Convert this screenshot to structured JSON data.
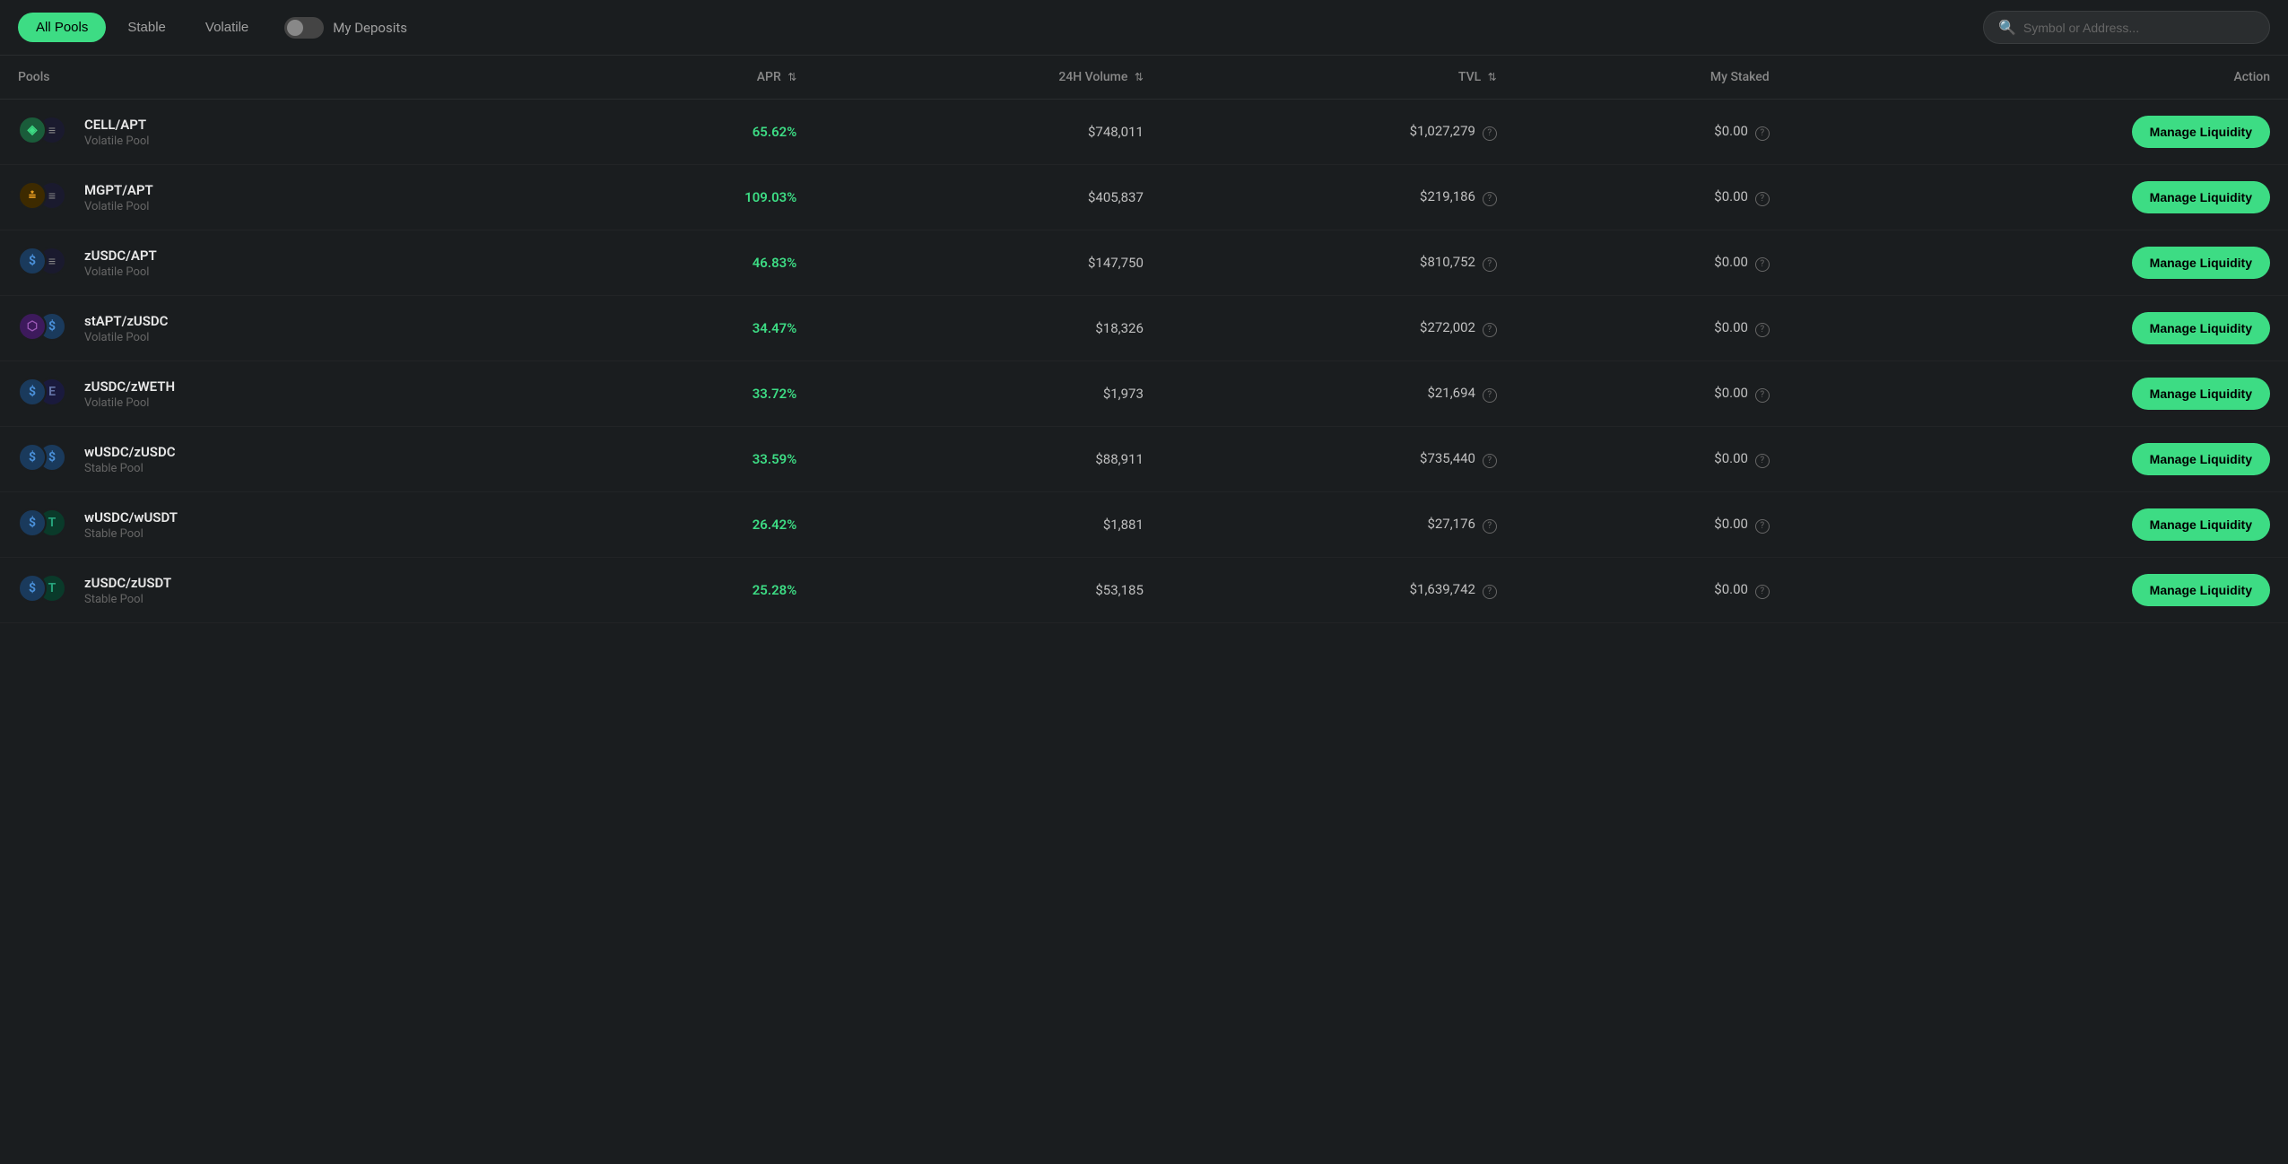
{
  "header": {
    "tabs": [
      {
        "id": "all",
        "label": "All Pools",
        "active": true
      },
      {
        "id": "stable",
        "label": "Stable",
        "active": false
      },
      {
        "id": "volatile",
        "label": "Volatile",
        "active": false
      }
    ],
    "toggle_label": "My Deposits",
    "search_placeholder": "Symbol or Address..."
  },
  "table": {
    "columns": [
      {
        "id": "pools",
        "label": "Pools",
        "sortable": false
      },
      {
        "id": "apr",
        "label": "APR",
        "sortable": true
      },
      {
        "id": "volume",
        "label": "24H Volume",
        "sortable": true
      },
      {
        "id": "tvl",
        "label": "TVL",
        "sortable": true
      },
      {
        "id": "staked",
        "label": "My Staked",
        "sortable": false
      },
      {
        "id": "action",
        "label": "Action",
        "sortable": false
      }
    ],
    "rows": [
      {
        "id": "cell-apt",
        "name": "CELL/APT",
        "type": "Volatile Pool",
        "icon1": "C",
        "icon2": "≡",
        "apr": "65.62%",
        "volume": "$748,011",
        "tvl": "$1,027,279",
        "staked": "$0.00",
        "btn": "Manage Liquidity"
      },
      {
        "id": "mgpt-apt",
        "name": "MGPT/APT",
        "type": "Volatile Pool",
        "icon1": "M",
        "icon2": "≡",
        "apr": "109.03%",
        "volume": "$405,837",
        "tvl": "$219,186",
        "staked": "$0.00",
        "btn": "Manage Liquidity"
      },
      {
        "id": "zusdc-apt",
        "name": "zUSDC/APT",
        "type": "Volatile Pool",
        "icon1": "$",
        "icon2": "≡",
        "apr": "46.83%",
        "volume": "$147,750",
        "tvl": "$810,752",
        "staked": "$0.00",
        "btn": "Manage Liquidity"
      },
      {
        "id": "stapt-zusdc",
        "name": "stAPT/zUSDC",
        "type": "Volatile Pool",
        "icon1": "st",
        "icon2": "$",
        "apr": "34.47%",
        "volume": "$18,326",
        "tvl": "$272,002",
        "staked": "$0.00",
        "btn": "Manage Liquidity"
      },
      {
        "id": "zusdc-zweth",
        "name": "zUSDC/zWETH",
        "type": "Volatile Pool",
        "icon1": "$",
        "icon2": "E",
        "apr": "33.72%",
        "volume": "$1,973",
        "tvl": "$21,694",
        "staked": "$0.00",
        "btn": "Manage Liquidity"
      },
      {
        "id": "wusdc-zusdc",
        "name": "wUSDC/zUSDC",
        "type": "Stable Pool",
        "icon1": "$",
        "icon2": "$",
        "apr": "33.59%",
        "volume": "$88,911",
        "tvl": "$735,440",
        "staked": "$0.00",
        "btn": "Manage Liquidity"
      },
      {
        "id": "wusdc-wusdt",
        "name": "wUSDC/wUSDT",
        "type": "Stable Pool",
        "icon1": "$",
        "icon2": "T",
        "apr": "26.42%",
        "volume": "$1,881",
        "tvl": "$27,176",
        "staked": "$0.00",
        "btn": "Manage Liquidity"
      },
      {
        "id": "zusdc-zusdt",
        "name": "zUSDC/zUSDT",
        "type": "Stable Pool",
        "icon1": "$",
        "icon2": "T",
        "apr": "25.28%",
        "volume": "$53,185",
        "tvl": "$1,639,742",
        "staked": "$0.00",
        "btn": "Manage Liquidity"
      }
    ]
  }
}
